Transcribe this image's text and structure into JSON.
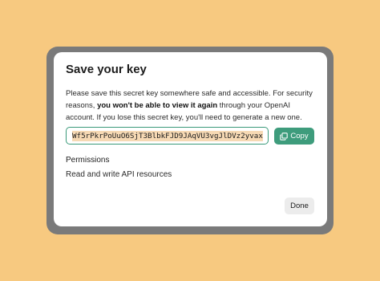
{
  "dialog": {
    "title": "Save your key",
    "description_part1": "Please save this secret key somewhere safe and accessible. For security reasons, ",
    "description_bold": "you won't be able to view it again",
    "description_part2": " through your OpenAI account. If you lose this secret key, you'll need to generate a new one.",
    "secret_key": "Wf5rPkrPoUuO6SjT3BlbkFJD9JAqVU3vgJlDVz2yvax",
    "copy_label": "Copy",
    "copy_icon": "copy-icon",
    "permissions_label": "Permissions",
    "permissions_value": "Read and write API resources",
    "done_label": "Done"
  },
  "colors": {
    "background": "#f7c980",
    "overlay": "#7a7a7a",
    "accent": "#3e9c7c",
    "key_highlight": "#f6d9b4"
  }
}
